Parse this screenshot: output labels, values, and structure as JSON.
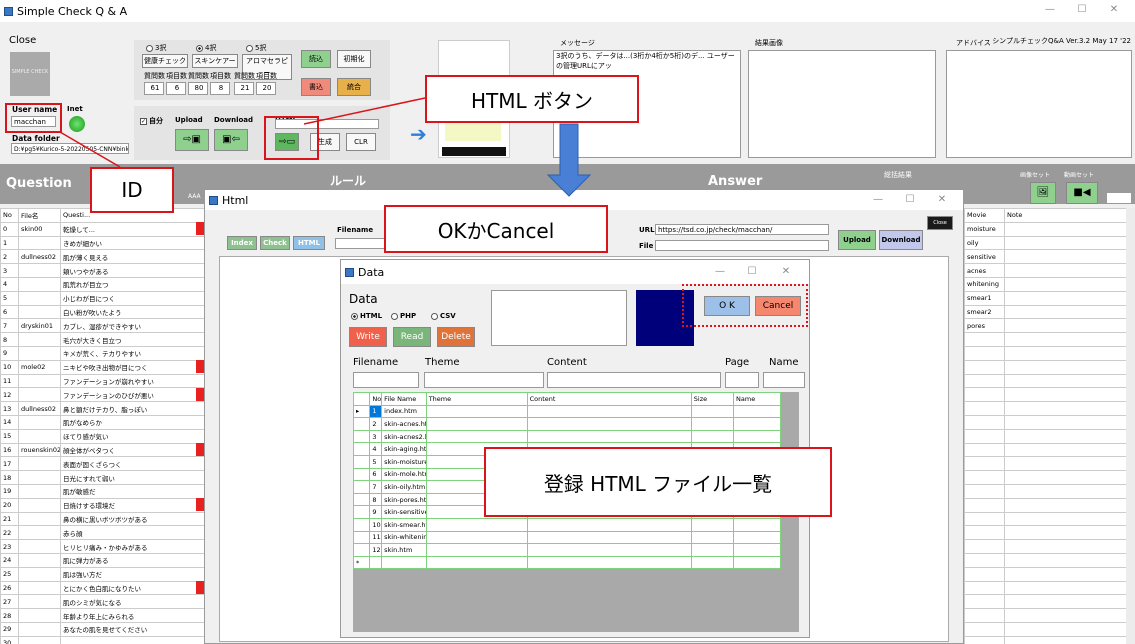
{
  "main": {
    "title": "Simple Check Q & A",
    "version": "シンプルチェックQ&A Ver.3.2 May 17 '22",
    "close": "Close",
    "logo": "SIMPLE CHECK",
    "radios": [
      "3択",
      "4択",
      "5択"
    ],
    "btns1": [
      "健康チェック",
      "スキンケアー",
      "アロマセラピー"
    ],
    "load": "読込",
    "init": "初期化",
    "write": "書込",
    "merge": "統合",
    "count_labels": [
      "質問数",
      "項目数",
      "質問数",
      "項目数",
      "質問数",
      "項目数"
    ],
    "counts": [
      "61",
      "6",
      "80",
      "8",
      "21",
      "20"
    ],
    "user_label": "User name",
    "user": "macchan",
    "inet": "Inet",
    "folder_label": "Data folder",
    "folder": "D:¥pg5¥Kurico-5-20220505-CNN¥bink",
    "self": "自分",
    "upload": "Upload",
    "download": "Download",
    "html": "HTML",
    "gen": "生成",
    "clr": "CLR",
    "msg_label": "メッセージ",
    "msg": "3択のうち、データは...(3桁か4桁か5桁)のデ... ユーザーの管理URLにアッ",
    "result_label": "結果画像",
    "advice_label": "アドバイス",
    "question": "Question",
    "rule": "ルール",
    "answer": "Answer",
    "diag": "総括結果",
    "img_set": "画像セット",
    "video_set": "動画セット",
    "aaa": "AAA",
    "col_no": "No",
    "col_file": "File名",
    "col_q": "Questi...",
    "col_movie": "Movie",
    "col_note": "Note",
    "rows": [
      [
        "0",
        "skin00",
        "乾燥して..."
      ],
      [
        "1",
        "",
        "きめが細かい"
      ],
      [
        "2",
        "dullness02",
        "肌が薄く見える"
      ],
      [
        "3",
        "",
        "頬いつやがある"
      ],
      [
        "4",
        "",
        "肌荒れが目立つ"
      ],
      [
        "5",
        "",
        "小じわが目につく"
      ],
      [
        "6",
        "",
        "白い粉が吹いたよう"
      ],
      [
        "7",
        "dryskin01",
        "カブレ、湿疹ができやすい"
      ],
      [
        "8",
        "",
        "毛穴が大きく目立つ"
      ],
      [
        "9",
        "",
        "キメが荒く、テカりやすい"
      ],
      [
        "10",
        "mole02",
        "ニキビや吹き出物が目につく"
      ],
      [
        "11",
        "",
        "ファンデーションが崩れやすい"
      ],
      [
        "12",
        "",
        "ファンデーションのひびが悪い"
      ],
      [
        "13",
        "dullness02",
        "鼻と額だけテカり、脂っぽい"
      ],
      [
        "14",
        "",
        "肌がなめらか"
      ],
      [
        "15",
        "",
        "ほてり感が気い"
      ],
      [
        "16",
        "rouenskin02",
        "顔全体がベタつく"
      ],
      [
        "17",
        "",
        "表面が固くざらつく"
      ],
      [
        "18",
        "",
        "日光にすれて弱い"
      ],
      [
        "19",
        "",
        "肌が敏感だ"
      ],
      [
        "20",
        "",
        "日焼けする環境だ"
      ],
      [
        "21",
        "",
        "鼻の横に黒いボツボツがある"
      ],
      [
        "22",
        "",
        "赤ら顔"
      ],
      [
        "23",
        "",
        "ヒリヒリ痛み・かゆみがある"
      ],
      [
        "24",
        "",
        "肌に弾力がある"
      ],
      [
        "25",
        "",
        "肌は強い方だ"
      ],
      [
        "26",
        "",
        "とにかく色白肌になりたい"
      ],
      [
        "27",
        "",
        "肌のシミが気になる"
      ],
      [
        "28",
        "",
        "年齢より年上にみられる"
      ],
      [
        "29",
        "",
        "あなたの肌を見せてください"
      ],
      [
        "30",
        "",
        ""
      ],
      [
        "31",
        "",
        ""
      ]
    ],
    "answer_rows": [
      "moisture",
      "oily",
      "sensitive",
      "acnes",
      "whitening",
      "smear1",
      "smear2",
      "pores",
      "",
      "",
      "",
      "",
      "",
      "",
      "",
      "",
      "",
      "",
      "",
      "",
      "",
      "",
      "",
      "",
      "",
      "",
      "",
      "",
      "",
      "",
      "",
      ""
    ]
  },
  "html_win": {
    "title": "Html",
    "tabs": [
      "Index",
      "Check",
      "HTML"
    ],
    "filename_label": "Filename",
    "url_label": "URL",
    "url": "https://tsd.co.jp/check/macchan/",
    "file_label": "File",
    "upload": "Upload",
    "download": "Download",
    "close": "Close"
  },
  "data_win": {
    "title": "Data",
    "heading": "Data",
    "radios": [
      "HTML",
      "PHP",
      "CSV"
    ],
    "write": "Write",
    "read": "Read",
    "delete": "Delete",
    "ok": "O K",
    "cancel": "Cancel",
    "labels": [
      "Filename",
      "Theme",
      "Content",
      "Page",
      "Name"
    ],
    "cols": [
      "No",
      "File Name",
      "Theme",
      "Content",
      "Size",
      "Name"
    ],
    "files": [
      "index.htm",
      "skin-acnes.htm",
      "skin-acnes2.htm",
      "skin-aging.htm",
      "skin-moisture.htm",
      "skin-mole.htm",
      "skin-oily.htm",
      "skin-pores.htm",
      "skin-sensitive.htm",
      "skin-smear.htm",
      "skin-whitening.ht...",
      "skin.htm"
    ]
  },
  "callouts": {
    "html_button": "HTML ボタン",
    "id": "ID",
    "ok_cancel": "OKかCancel",
    "file_list": "登録 HTML ファイル一覧"
  },
  "colors": {
    "accent_red": "#d9141b",
    "write": "#f0604a",
    "read": "#7ab57a",
    "delete": "#e0733a",
    "cancel": "#f5876f",
    "ok": "#9dc0e8",
    "navy": "#00007a",
    "green_btn": "#8fd08f"
  }
}
